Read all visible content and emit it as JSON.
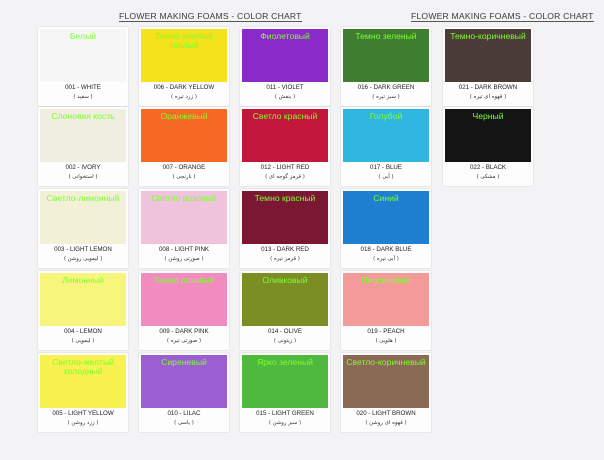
{
  "titles": {
    "left": "FLOWER MAKING FOAMS - COLOR CHART",
    "right": "FLOWER MAKING FOAMS - COLOR CHART"
  },
  "swatches": [
    {
      "ru": "Белый",
      "code": "001 - WHITE",
      "fa": "( سفید )",
      "color": "#f6f6f6"
    },
    {
      "ru": "Темно-желтый теплый",
      "code": "006 - DARK YELLOW",
      "fa": "( زرد تیره )",
      "color": "#f4e21c"
    },
    {
      "ru": "Фиолетовый",
      "code": "011 - VIOLET",
      "fa": "( بنفش )",
      "color": "#8a2bc9"
    },
    {
      "ru": "Темно зеленый",
      "code": "016 - DARK GREEN",
      "fa": "( سبز تیره )",
      "color": "#3f7d31"
    },
    {
      "ru": "Темно-коричневый",
      "code": "021 - DARK BROWN",
      "fa": "( قهوه ای تیره )",
      "color": "#4a3c36"
    },
    {
      "ru": "Слоновая кость",
      "code": "002 - IVORY",
      "fa": "( استخوانی )",
      "color": "#efeee0"
    },
    {
      "ru": "Оранжевый",
      "code": "007 - ORANGE",
      "fa": "( نارنجی )",
      "color": "#f56922"
    },
    {
      "ru": "Светло красный",
      "code": "012 - LIGHT RED",
      "fa": "( قرمز گوجه ای )",
      "color": "#c3163b"
    },
    {
      "ru": "Голубой",
      "code": "017 - BLUE",
      "fa": "( آبی )",
      "color": "#2fb7e0"
    },
    {
      "ru": "Черный",
      "code": "022 - BLACK",
      "fa": "( مشکی )",
      "color": "#141414"
    },
    {
      "ru": "Светло-лимонный",
      "code": "003 - LIGHT LEMON",
      "fa": "( لیمویی روشن )",
      "color": "#f2f0d6"
    },
    {
      "ru": "Светло розовый",
      "code": "008 - LIGHT PINK",
      "fa": "( صورتی روشن )",
      "color": "#f0c3dc"
    },
    {
      "ru": "Темно красный",
      "code": "013 - DARK RED",
      "fa": "( قرمز تیره )",
      "color": "#7b1733"
    },
    {
      "ru": "Синий",
      "code": "018 - DARK BLUE",
      "fa": "( آبی تیره )",
      "color": "#1f7fd0"
    },
    {
      "ru": "Лимонный",
      "code": "004 - LEMON",
      "fa": "( لیمویی )",
      "color": "#f8f57c"
    },
    {
      "ru": "Темно розовый",
      "code": "009 - DARK PINK",
      "fa": "( صورتی تیره )",
      "color": "#f28cc0"
    },
    {
      "ru": "Оливковый",
      "code": "014 - OLIVE",
      "fa": "( زیتونی )",
      "color": "#7a8e24"
    },
    {
      "ru": "Персиковый",
      "code": "019 - PEACH",
      "fa": "( هلویی )",
      "color": "#f49a9a"
    },
    {
      "ru": "Светло-желтый холодный",
      "code": "005 - LIGHT YELLOW",
      "fa": "( زرد روشن )",
      "color": "#f7f24f"
    },
    {
      "ru": "Сиреневый",
      "code": "010 - LILAC",
      "fa": "( یاسی )",
      "color": "#9b5ed3"
    },
    {
      "ru": "Ярко зеленый",
      "code": "015 - LIGHT GREEN",
      "fa": "( سبز روشن )",
      "color": "#4fb83e"
    },
    {
      "ru": "Светло-коричневый",
      "code": "020 - LIGHT BROWN",
      "fa": "( قهوه ای روشن )",
      "color": "#8a6a55"
    }
  ]
}
